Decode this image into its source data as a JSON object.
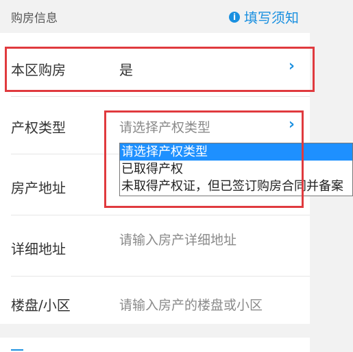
{
  "header": {
    "title": "购房信息",
    "help_link": "填写须知"
  },
  "rows": [
    {
      "label": "本区购房",
      "value": "是"
    },
    {
      "label": "产权类型",
      "placeholder": "请选择产权类型"
    },
    {
      "label": "房产地址"
    },
    {
      "label": "详细地址",
      "placeholder": "请输入房产详细地址"
    },
    {
      "label": "楼盘/小区",
      "placeholder": "请输入房产的楼盘或小区"
    }
  ],
  "dropdown": {
    "options": [
      "请选择产权类型",
      "已取得产权",
      "未取得产权证，但已签订购房合同并备案"
    ],
    "selected": "请选择产权类型"
  },
  "colors": {
    "accent": "#1a90e0",
    "highlight": "#e03a3e",
    "selected_option": "#1e90ff"
  }
}
